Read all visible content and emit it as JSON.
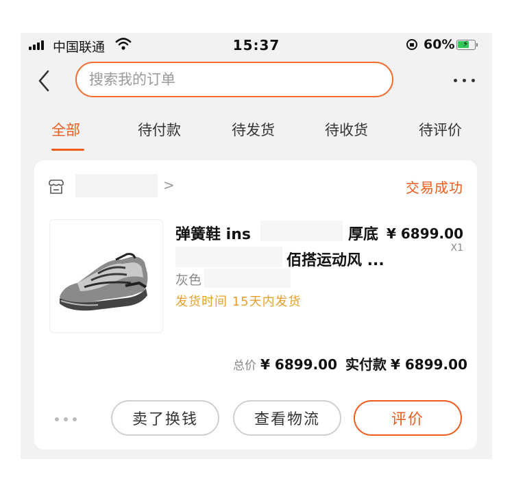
{
  "status_bar": {
    "carrier": "中国联通",
    "time": "15:37",
    "battery": "60%"
  },
  "header": {
    "search_placeholder": "搜索我的订单"
  },
  "tabs": [
    {
      "label": "全部",
      "active": true
    },
    {
      "label": "待付款",
      "active": false
    },
    {
      "label": "待发货",
      "active": false
    },
    {
      "label": "待收货",
      "active": false
    },
    {
      "label": "待评价",
      "active": false
    }
  ],
  "order": {
    "status": "交易成功",
    "product": {
      "title_part1": "弹簧鞋 ins",
      "title_part2": "厚底",
      "title_part3": "佰搭运动风 ...",
      "price": "¥ 6899.00",
      "quantity": "X1",
      "spec_label": "灰色",
      "delivery_note": "发货时间 15天内发货"
    },
    "totals": {
      "total_label": "总价",
      "total_value": "¥ 6899.00",
      "paid_label": "实付款",
      "paid_value": "¥ 6899.00"
    },
    "actions": {
      "sell": "卖了换钱",
      "logistics": "查看物流",
      "review": "评价"
    }
  },
  "colors": {
    "accent": "#f05a1a",
    "delivery": "#e8a02a",
    "background": "#f2f2f2"
  }
}
